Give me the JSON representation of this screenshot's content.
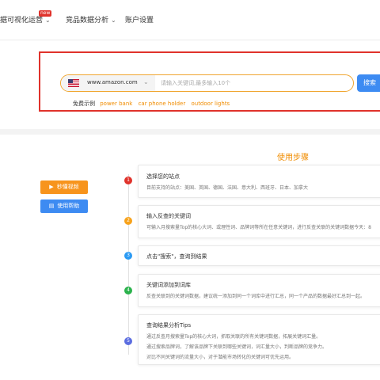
{
  "nav": {
    "item1": "据可视化运营",
    "item1_badge": "new",
    "item2": "竞品数据分析",
    "item3": "账户设置"
  },
  "search": {
    "site": "www.amazon.com",
    "placeholder": "请输入关键词,最多输入10个",
    "button": "搜索",
    "examples_label": "免费示例",
    "examples": [
      "power bank",
      "car phone holder",
      "outdoor lights"
    ]
  },
  "side_buttons": {
    "video": "秒懂视频",
    "help": "使用帮助"
  },
  "steps": {
    "title": "使用步骤",
    "items": [
      {
        "num": "1",
        "title": "选择您的站点",
        "desc": [
          "目前支持的站点：美国、英国、德国、法国、意大利、西班牙、日本、加拿大"
        ],
        "color": "#e0322b"
      },
      {
        "num": "2",
        "title": "输入反查的关键词",
        "desc": [
          "可输入月搜索量Top的核心大词、或理性词、品牌词等所在任意关键词，进行反查关联的关键词数据今天：8"
        ],
        "color": "#f7a21b"
      },
      {
        "num": "3",
        "title": "点击\"搜索\"，查询到结果",
        "desc": [],
        "color": "#2b9af3"
      },
      {
        "num": "4",
        "title": "关键词添加到词库",
        "desc": [
          "反查关联到的关键词数据，建议统一添加到同一个词库中进行汇总，同一个产品的数据最好汇总到一起。"
        ],
        "color": "#2bb24c"
      },
      {
        "num": "5",
        "title": "查询结果分析Tips",
        "desc": [
          "通过反查月搜索量Top的核心大词，抓取关联的所有关键词数据，拓展关键词汇量。",
          "通过搜索品牌词，了解该品牌下关联到哪些关键词，词汇量大小，判断品牌的竞争力。",
          "对比不同关键词的流量大小，对于潜能市场转化的关键词可优先运用。"
        ],
        "color": "#5b6de0"
      }
    ]
  }
}
